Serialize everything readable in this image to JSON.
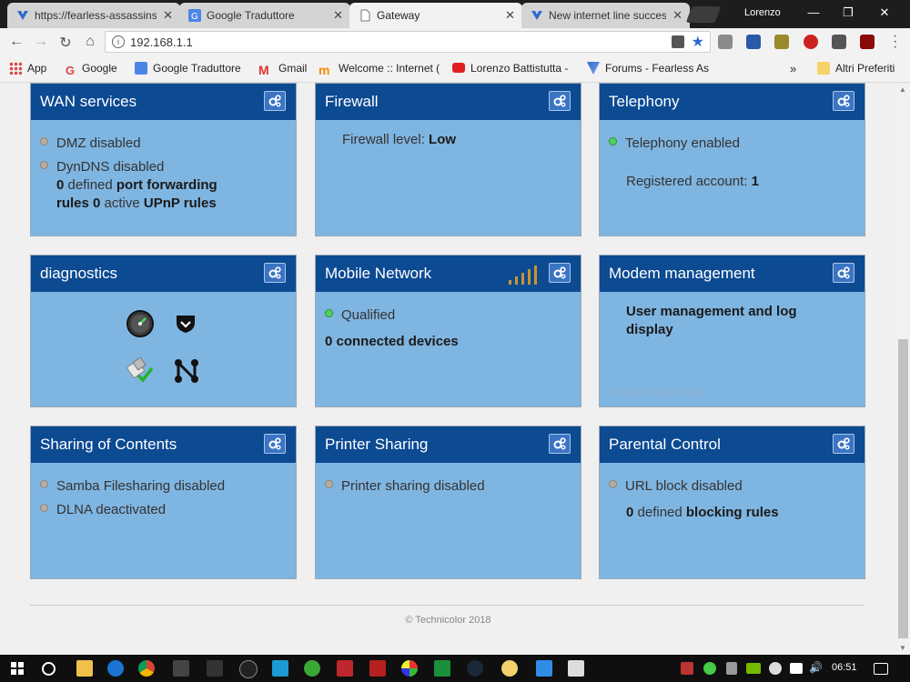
{
  "browser": {
    "tabs": [
      {
        "label": "https://fearless-assassins",
        "fav_color": "#2f6ad0"
      },
      {
        "label": "Google Traduttore",
        "fav_color": "#4a86e8"
      },
      {
        "label": "Gateway",
        "fav_color": "#888888"
      },
      {
        "label": "New internet line succes",
        "fav_color": "#2f6ad0"
      }
    ],
    "user": "Lorenzo",
    "window_controls": {
      "minimize": "—",
      "restore": "❐",
      "close": "✕"
    },
    "tab_close": "✕",
    "url": "192.168.1.1",
    "nav": {
      "back": "←",
      "forward": "→",
      "reload": "↻",
      "home": "⌂"
    },
    "star": "★"
  },
  "bookmarks": {
    "items": [
      {
        "label": "App",
        "icon": "apps-grid-icon"
      },
      {
        "label": "Google",
        "icon": "google-icon"
      },
      {
        "label": "Google Traduttore",
        "icon": "translate-icon"
      },
      {
        "label": "Gmail",
        "icon": "gmail-icon"
      },
      {
        "label": "Welcome :: Internet (",
        "icon": "moodle-icon"
      },
      {
        "label": "Lorenzo Battistutta -",
        "icon": "youtube-icon"
      },
      {
        "label": "Forums - Fearless As",
        "icon": "forum-icon"
      }
    ],
    "more": "»",
    "other_folder": "Altri Preferiti"
  },
  "cards": {
    "wan": {
      "title": "WAN services",
      "dmz": "DMZ disabled",
      "dyndns": "DynDNS disabled",
      "pf_count": "0",
      "pf_text": " defined ",
      "pf_bold": "port forwarding",
      "rules_bold": "rules",
      "upnp_count": " 0",
      "upnp_text": " active ",
      "upnp_bold": "UPnP rules"
    },
    "firewall": {
      "title": "Firewall",
      "level_label": "Firewall level: ",
      "level_value": "Low"
    },
    "telephony": {
      "title": "Telephony",
      "status": "Telephony enabled",
      "registered_label": "Registered account: ",
      "registered_value": "1"
    },
    "diagnostics": {
      "title": "diagnostics"
    },
    "mobile": {
      "title": "Mobile Network",
      "status": "Qualified",
      "devices": "0 connected devices",
      "signal_bars": 5
    },
    "modem": {
      "title": "Modem management",
      "line1": "User management and log",
      "line2": "display",
      "watermark": "Cattura schermo intero"
    },
    "sharing": {
      "title": "Sharing of Contents",
      "samba": "Samba Filesharing disabled",
      "dlna": "DLNA deactivated"
    },
    "printer": {
      "title": "Printer Sharing",
      "status": "Printer sharing disabled"
    },
    "parental": {
      "title": "Parental Control",
      "status": "URL block disabled",
      "rules_count": "0",
      "rules_text": " defined ",
      "rules_bold": "blocking rules"
    }
  },
  "footer": "© Technicolor 2018",
  "taskbar": {
    "time": "06:51"
  },
  "colors": {
    "card_header": "#0c4a92",
    "card_body": "#7fb5e1",
    "status_green": "#4ed35a",
    "status_grey": "#b9aca0",
    "signal": "#c89530"
  }
}
